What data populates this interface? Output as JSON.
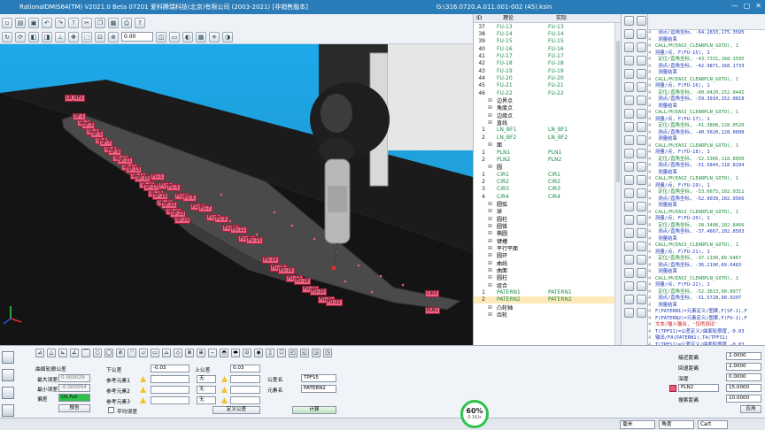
{
  "window": {
    "title": "RationalDMIS64(TM) V2021.0 Beta 07201   爱科腾瑞科技(北京)有限公司 (2003-2021) [非销售版本]",
    "file_path": "G:\\316.0720.A.011.001-002 (45).ksin"
  },
  "toolbar": {
    "zoom_value": "0.00"
  },
  "viewport": {
    "labels": [
      "LN_BF2",
      "SF-1",
      "SF-2",
      "SF-3",
      "SF-4",
      "SF-5",
      "SF-6",
      "SF-7",
      "SF-8",
      "SF-9",
      "SF-10",
      "SF-11",
      "SF-12",
      "SF-13",
      "SF-14",
      "SF-15",
      "SF-16",
      "SF-17",
      "SF-18",
      "SF-19",
      "SF-20",
      "SF-21",
      "SF-22",
      "SF-23",
      "SF-24",
      "FU-1",
      "FU-2",
      "FU-3",
      "FU-4",
      "FU-5",
      "FU-6",
      "FU-7",
      "FU-8",
      "FU-9",
      "FU-10",
      "FU-11",
      "FU-12",
      "FU-13",
      "FU-14",
      "FU-15",
      "FU-16",
      "FU-17",
      "FU-18",
      "FU-19",
      "FU-20",
      "FU-21",
      "FU-22",
      "CIR3",
      "PLN1"
    ]
  },
  "tree": {
    "columns": [
      "ID",
      "理论",
      "实际"
    ],
    "rows": [
      {
        "id": "37",
        "theo": "FU-13",
        "act": "FU-13",
        "type": "feat"
      },
      {
        "id": "38",
        "theo": "FU-14",
        "act": "FU-14",
        "type": "feat"
      },
      {
        "id": "39",
        "theo": "FU-15",
        "act": "FU-15",
        "type": "feat"
      },
      {
        "id": "40",
        "theo": "FU-16",
        "act": "FU-16",
        "type": "feat"
      },
      {
        "id": "41",
        "theo": "FU-17",
        "act": "FU-17",
        "type": "feat"
      },
      {
        "id": "42",
        "theo": "FU-18",
        "act": "FU-18",
        "type": "feat"
      },
      {
        "id": "43",
        "theo": "FU-19",
        "act": "FU-19",
        "type": "feat"
      },
      {
        "id": "44",
        "theo": "FU-20",
        "act": "FU-20",
        "type": "feat"
      },
      {
        "id": "45",
        "theo": "FU-21",
        "act": "FU-21",
        "type": "feat"
      },
      {
        "id": "46",
        "theo": "FU-22",
        "act": "FU-22",
        "type": "feat"
      },
      {
        "id": "",
        "theo": "边界点",
        "act": "",
        "type": "group"
      },
      {
        "id": "",
        "theo": "角度点",
        "act": "",
        "type": "group"
      },
      {
        "id": "",
        "theo": "边缘点",
        "act": "",
        "type": "group"
      },
      {
        "id": "",
        "theo": "直线",
        "act": "",
        "type": "group"
      },
      {
        "id": "1",
        "theo": "LN_BF1",
        "act": "LN_BF1",
        "type": "feat"
      },
      {
        "id": "2",
        "theo": "LN_BF2",
        "act": "LN_BF2",
        "type": "feat"
      },
      {
        "id": "",
        "theo": "面",
        "act": "",
        "type": "group"
      },
      {
        "id": "1",
        "theo": "PLN1",
        "act": "PLN1",
        "type": "feat"
      },
      {
        "id": "2",
        "theo": "PLN2",
        "act": "PLN2",
        "type": "feat"
      },
      {
        "id": "",
        "theo": "圆",
        "act": "",
        "type": "group"
      },
      {
        "id": "1",
        "theo": "CIR1",
        "act": "CIR1",
        "type": "feat"
      },
      {
        "id": "2",
        "theo": "CIR2",
        "act": "CIR2",
        "type": "feat"
      },
      {
        "id": "3",
        "theo": "CIR3",
        "act": "CIR3",
        "type": "feat"
      },
      {
        "id": "4",
        "theo": "CIR4",
        "act": "CIR4",
        "type": "feat"
      },
      {
        "id": "",
        "theo": "圆弧",
        "act": "",
        "type": "group"
      },
      {
        "id": "",
        "theo": "球",
        "act": "",
        "type": "group"
      },
      {
        "id": "",
        "theo": "圆柱",
        "act": "",
        "type": "group"
      },
      {
        "id": "",
        "theo": "圆锥",
        "act": "",
        "type": "group"
      },
      {
        "id": "",
        "theo": "椭圆",
        "act": "",
        "type": "group"
      },
      {
        "id": "",
        "theo": "键槽",
        "act": "",
        "type": "group"
      },
      {
        "id": "",
        "theo": "平行平面",
        "act": "",
        "type": "group"
      },
      {
        "id": "",
        "theo": "圆环",
        "act": "",
        "type": "group"
      },
      {
        "id": "",
        "theo": "曲线",
        "act": "",
        "type": "group"
      },
      {
        "id": "",
        "theo": "曲面",
        "act": "",
        "type": "group"
      },
      {
        "id": "",
        "theo": "圆柱",
        "act": "",
        "type": "group"
      },
      {
        "id": "",
        "theo": "组合",
        "act": "",
        "type": "group"
      },
      {
        "id": "1",
        "theo": "PATERN1",
        "act": "PATERN1",
        "type": "feat"
      },
      {
        "id": "2",
        "theo": "PATERN2",
        "act": "PATERN2",
        "type": "sel"
      },
      {
        "id": "",
        "theo": "凸轮轴",
        "act": "",
        "type": "group"
      },
      {
        "id": "",
        "theo": "齿轮",
        "act": "",
        "type": "group"
      }
    ]
  },
  "code": {
    "lines": [
      {
        "n": "4",
        "t": "  测点/直角坐标, -64.2833,175.3595",
        "c": "c-blue"
      },
      {
        "n": "4",
        "t": "  测量结束",
        "c": "c-blue"
      },
      {
        "n": "4",
        "t": "CALL/M(EASI_CLEARPLN_GOTO), 1",
        "c": "c-green"
      },
      {
        "n": "4",
        "t": "测量/点, F(FU-15), 1",
        "c": "c-blue"
      },
      {
        "n": "4",
        "t": "  定位/直角坐标, -43.7331,168.1595",
        "c": "c-green"
      },
      {
        "n": "4",
        "t": "  测点/直角坐标, -42.9871,168.1733",
        "c": "c-blue"
      },
      {
        "n": "4",
        "t": "  测量结束",
        "c": "c-blue"
      },
      {
        "n": "4",
        "t": "CALL/M(EASI_CLEARPLN_GOTO), 1",
        "c": "c-green"
      },
      {
        "n": "4",
        "t": "测量/点, F(FU-16), 1",
        "c": "c-blue"
      },
      {
        "n": "4",
        "t": "  定位/直角坐标, -60.0420,152.0442",
        "c": "c-green"
      },
      {
        "n": "4",
        "t": "  测点/直角坐标, -59.3910,152.0818",
        "c": "c-blue"
      },
      {
        "n": "4",
        "t": "  测量结束",
        "c": "c-blue"
      },
      {
        "n": "4",
        "t": "CALL/M(EASI_CLEARPLN_GOTO), 1",
        "c": "c-green"
      },
      {
        "n": "4",
        "t": "测量/点, F(FU-17), 1",
        "c": "c-blue"
      },
      {
        "n": "4",
        "t": "  定位/直角坐标, -41.3808,128.0520",
        "c": "c-green"
      },
      {
        "n": "4",
        "t": "  测点/直角坐标, -40.5620,128.0608",
        "c": "c-blue"
      },
      {
        "n": "4",
        "t": "  测量结束",
        "c": "c-blue"
      },
      {
        "n": "4",
        "t": "CALL/M(EASI_CLEARPLN_GOTO), 1",
        "c": "c-green"
      },
      {
        "n": "4",
        "t": "测量/点, F(FU-18), 1",
        "c": "c-blue"
      },
      {
        "n": "4",
        "t": "  定位/直角坐标, -52.3366,118.8050",
        "c": "c-green"
      },
      {
        "n": "4",
        "t": "  测点/直角坐标, -51.5844,118.8294",
        "c": "c-blue"
      },
      {
        "n": "4",
        "t": "  测量结束",
        "c": "c-blue"
      },
      {
        "n": "4",
        "t": "CALL/M(EASI_CLEARPLN_GOTO), 1",
        "c": "c-green"
      },
      {
        "n": "4",
        "t": "测量/点, F(FU-19), 1",
        "c": "c-blue"
      },
      {
        "n": "4",
        "t": "  定位/直角坐标, -53.6675,102.9311",
        "c": "c-green"
      },
      {
        "n": "4",
        "t": "  测点/直角坐标, -52.9039,102.9566",
        "c": "c-blue"
      },
      {
        "n": "4",
        "t": "  测量结束",
        "c": "c-blue"
      },
      {
        "n": "4",
        "t": "CALL/M(EASI_CLEARPLN_GOTO), 1",
        "c": "c-green"
      },
      {
        "n": "4",
        "t": "测量/点, F(FU-20), 1",
        "c": "c-blue"
      },
      {
        "n": "4",
        "t": "  定位/直角坐标, -38.3408,102.8466",
        "c": "c-green"
      },
      {
        "n": "4",
        "t": "  测点/直角坐标, -37.4667,102.8503",
        "c": "c-blue"
      },
      {
        "n": "4",
        "t": "  测量结束",
        "c": "c-blue"
      },
      {
        "n": "4",
        "t": "CALL/M(EASI_CLEARPLN_GOTO), 1",
        "c": "c-green"
      },
      {
        "n": "4",
        "t": "测量/点, F(FU-21), 1",
        "c": "c-blue"
      },
      {
        "n": "4",
        "t": "  定位/直角坐标, -37.1190,89.6467",
        "c": "c-green"
      },
      {
        "n": "4",
        "t": "  测点/直角坐标, -36.2190,89.6483",
        "c": "c-blue"
      },
      {
        "n": "4",
        "t": "  测量结束",
        "c": "c-blue"
      },
      {
        "n": "4",
        "t": "CALL/M(EASI_CLEARPLN_GOTO), 1",
        "c": "c-green"
      },
      {
        "n": "4",
        "t": "测量/点, F(FU-22), 1",
        "c": "c-blue"
      },
      {
        "n": "4",
        "t": "  定位/直角坐标, -52.3613,90.8977",
        "c": "c-green"
      },
      {
        "n": "4",
        "t": "  测点/直角坐标, -51.5728,90.9207",
        "c": "c-blue"
      },
      {
        "n": "4",
        "t": "  测量结束",
        "c": "c-blue"
      },
      {
        "n": "4",
        "t": "F(PATERN1)=元素定义/图案,F(SF-1),F",
        "c": "c-blue"
      },
      {
        "n": "4",
        "t": "F(PATERN2)=元素定义/图案,F(FU-1),F",
        "c": "c-blue"
      },
      {
        "n": "4",
        "t": "文本/输入输出, '仅供测试'",
        "c": "c-red"
      },
      {
        "n": "4",
        "t": "T(TPFS1)=公差定义/曲面轮廓度,-0.03",
        "c": "c-blue"
      },
      {
        "n": "4",
        "t": "输出/FA(PATERN1),TA(TPFS1)",
        "c": "c-blue"
      },
      {
        "n": "4",
        "t": "T(TPFS2)=公差定义/曲面轮廓度,-0.03",
        "c": "c-blue"
      },
      {
        "n": "4",
        "t": "输出/FA(PATERN2),TA(TPFS2)",
        "c": "c-blue"
      },
      {
        "n": "4",
        "t": "文本/输入输出, '再次测量'",
        "c": "c-red"
      },
      {
        "n": "4",
        "t": "T(TPFS3)=公差定义/曲面轮廓度,-0.03",
        "c": "c-blue"
      },
      {
        "n": "4",
        "t": "输出/FA(PATERN1),TA(TPFS3)",
        "c": "c-blue"
      },
      {
        "n": "4",
        "t": "T(TPFS4)=公差定义/曲面轮廓度,-0.03",
        "c": "c-blue"
      },
      {
        "n": "4",
        "t": "输出/FA(PATERN2),TA(TPFS4)",
        "c": "c-blue"
      }
    ]
  },
  "tolerance": {
    "title": "曲面轮廓公差",
    "max_error_label": "最大误差",
    "max_error_value": "0.000029",
    "min_error_label": "最小误差",
    "min_error_value": "-0.000054",
    "status_label": "偏差",
    "status_value": "Ok.Fail",
    "report_button": "报告",
    "lower_tol_label": "下公差",
    "lower_tol_value": "-0.03",
    "upper_tol_label": "上公差",
    "upper_tol_value": "0.03",
    "ref1_label": "参考元素1",
    "ref2_label": "参考元素2",
    "ref3_label": "参考元素3",
    "ref_none": "无",
    "avg_error_label": "平均误差",
    "define_datum_button": "定义公差",
    "tol_name_label": "公差名",
    "tol_name_value": "TPFS5",
    "feature_label": "元素名",
    "feature_value": "PATERN2",
    "calc_button": "计算"
  },
  "motion": {
    "approach_label": "接近距离",
    "approach_value": "2.0000",
    "retract_label": "回退距离",
    "retract_value": "2.0000",
    "depth_label": "深度",
    "depth_value": "0.0000",
    "plane_value": "PLN2",
    "plane_dist_value": "15.0000",
    "search_label": "搜索距离",
    "search_value": "10.0000",
    "apply_button": "应用"
  },
  "status": {
    "unit": "毫米",
    "angle": "角度",
    "coord": "Cart",
    "gauge_value": "60%",
    "gauge_speed": "0.1K/s"
  }
}
